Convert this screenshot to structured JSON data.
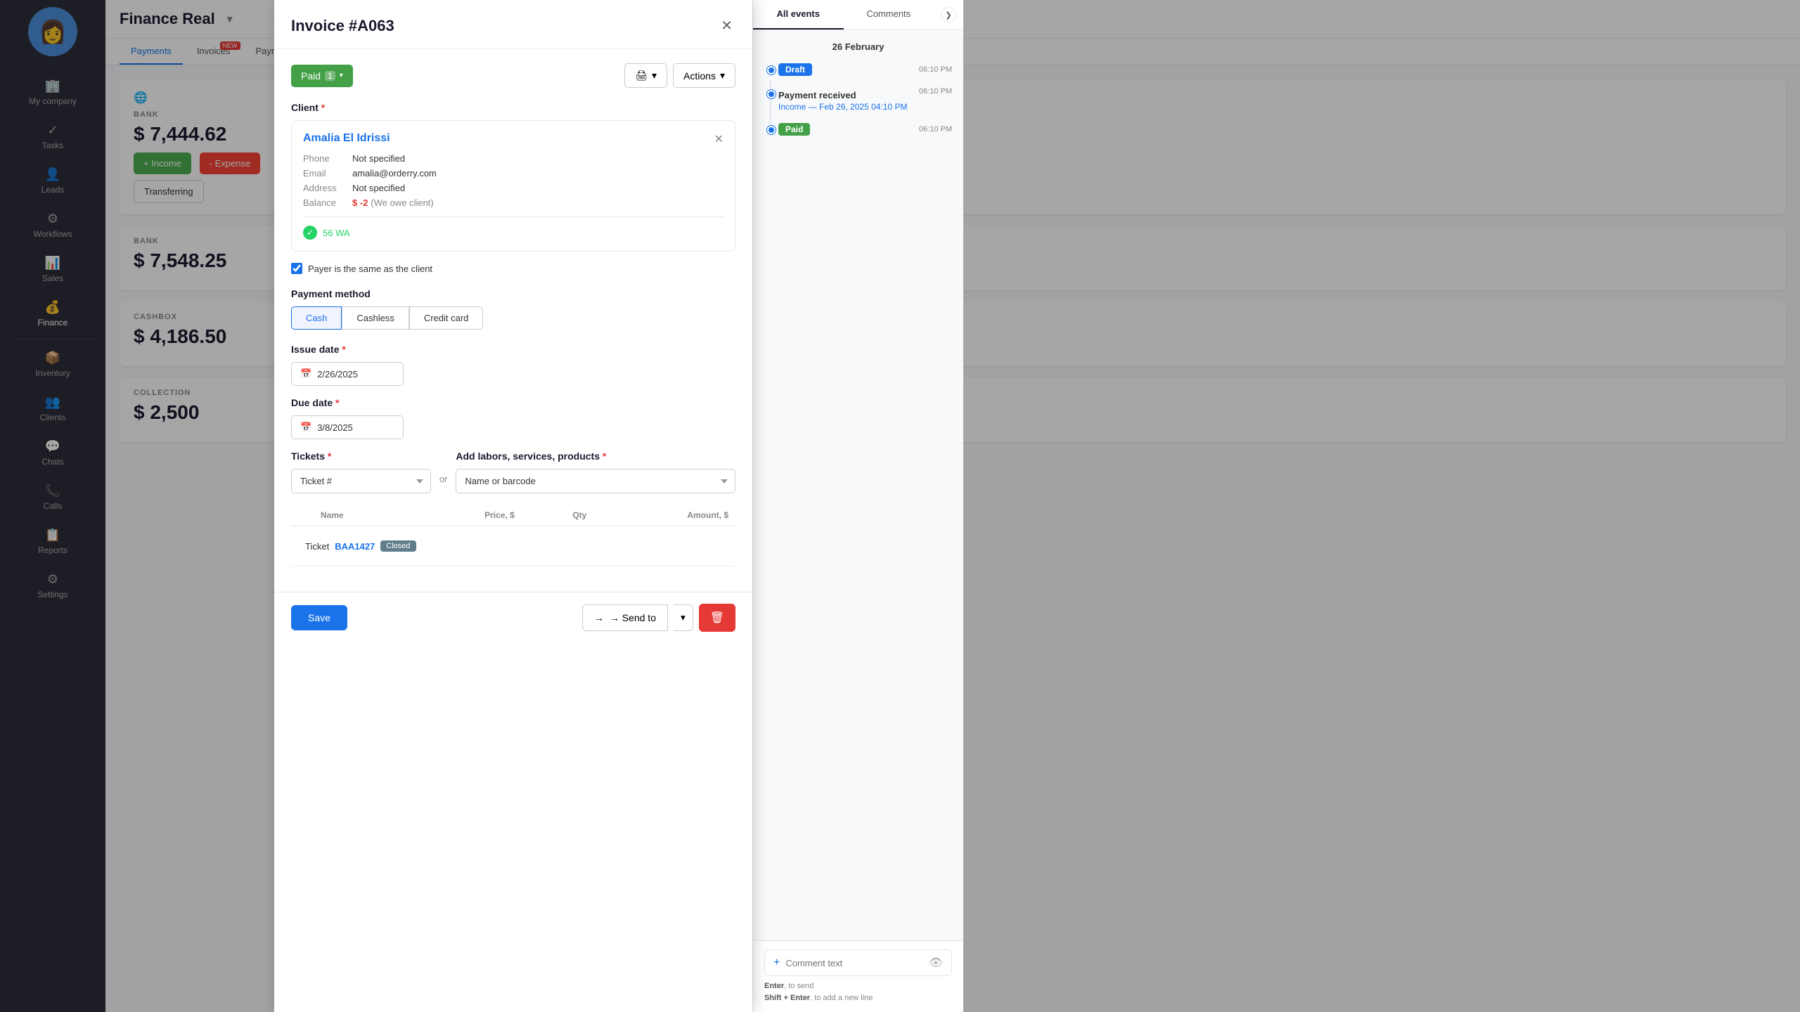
{
  "sidebar": {
    "avatar_emoji": "👩",
    "items": [
      {
        "id": "my-company",
        "label": "My company",
        "icon": "🏢"
      },
      {
        "id": "tasks",
        "label": "Tasks",
        "icon": "✓"
      },
      {
        "id": "leads",
        "label": "Leads",
        "icon": "👤"
      },
      {
        "id": "workflows",
        "label": "Workflows",
        "icon": "⚙"
      },
      {
        "id": "sales",
        "label": "Sales",
        "icon": "📊"
      },
      {
        "id": "finance",
        "label": "Finance",
        "icon": "💰",
        "active": true
      },
      {
        "id": "inventory",
        "label": "Inventory",
        "icon": "📦"
      },
      {
        "id": "clients",
        "label": "Clients",
        "icon": "👥"
      },
      {
        "id": "chats",
        "label": "Chats",
        "icon": "💬"
      },
      {
        "id": "calls",
        "label": "Calls",
        "icon": "📞"
      },
      {
        "id": "reports",
        "label": "Reports",
        "icon": "📋"
      },
      {
        "id": "settings",
        "label": "Settings",
        "icon": "⚙"
      }
    ]
  },
  "topbar": {
    "title": "Finance Real",
    "caret": "▼",
    "dots": "· · · · · · · · · · · · · · ·"
  },
  "tabs": [
    {
      "id": "payments",
      "label": "Payments",
      "active": true
    },
    {
      "id": "invoices",
      "label": "Invoices",
      "badge": "NEW"
    },
    {
      "id": "paymentmethods",
      "label": "Payment methods"
    }
  ],
  "finance": {
    "bank": {
      "label": "BANK",
      "amount": "$ 7,444.62",
      "btn_income": "+ Income",
      "btn_expense": "- Expense",
      "btn_transfer": "Transferring"
    },
    "bank2": {
      "label": "BANK",
      "amount": "$ 7,548.25"
    },
    "cashbox": {
      "label": "CASHBOX",
      "amount": "$ 4,186.50"
    },
    "collection": {
      "label": "COLLECTION",
      "amount": "$ 2,500"
    }
  },
  "modal": {
    "title": "Invoice #A063",
    "status": {
      "label": "Paid",
      "count": "1",
      "caret": "▾"
    },
    "print_btn": "🖨",
    "print_caret": "▾",
    "actions_btn": "Actions",
    "actions_caret": "▾",
    "client_section": {
      "label": "Client",
      "client_name": "Amalia El Idrissi",
      "phone_label": "Phone",
      "phone_value": "Not specified",
      "email_label": "Email",
      "email_value": "amalia@orderry.com",
      "address_label": "Address",
      "address_value": "Not specified",
      "balance_label": "Balance",
      "balance_value": "$ -2",
      "balance_note": "(We owe client)",
      "whatsapp_label": "56 WA"
    },
    "payer_checkbox": "Payer is the same as the client",
    "payment_method": {
      "label": "Payment method",
      "options": [
        "Cash",
        "Cashless",
        "Credit card"
      ],
      "active": "Cash"
    },
    "issue_date": {
      "label": "Issue date",
      "value": "2/26/2025"
    },
    "due_date": {
      "label": "Due date",
      "value": "3/8/2025"
    },
    "tickets": {
      "label": "Tickets",
      "placeholder": "Ticket #"
    },
    "services": {
      "label": "Add labors, services, products",
      "placeholder": "Name or barcode"
    },
    "or_text": "or",
    "table": {
      "headers": [
        "Name",
        "Price, $",
        "Qty",
        "Amount, $"
      ],
      "ticket_label": "Ticket",
      "ticket_id": "BAA1427",
      "ticket_status": "Closed"
    },
    "footer": {
      "save_btn": "Save",
      "send_to_btn": "→ Send to",
      "send_to_caret": "▾",
      "delete_btn": "🗑"
    }
  },
  "right_panel": {
    "tabs": [
      {
        "id": "all-events",
        "label": "All events",
        "active": true
      },
      {
        "id": "comments",
        "label": "Comments"
      }
    ],
    "date_header": "26 February",
    "collapse_icon": "❯",
    "timeline": [
      {
        "badge": "Draft",
        "badge_type": "draft",
        "time": "06:10 PM"
      },
      {
        "event_title": "Payment received",
        "event_sub": "Income — Feb 26, 2025 04:10 PM",
        "time": "06:10 PM"
      },
      {
        "badge": "Paid",
        "badge_type": "paid",
        "time": "06:10 PM"
      }
    ],
    "comment_placeholder": "Comment text",
    "comment_hints": {
      "enter": "Enter",
      "enter_action": ", to send",
      "shift": "Shift + Enter",
      "shift_action": ", to add a new line"
    }
  }
}
